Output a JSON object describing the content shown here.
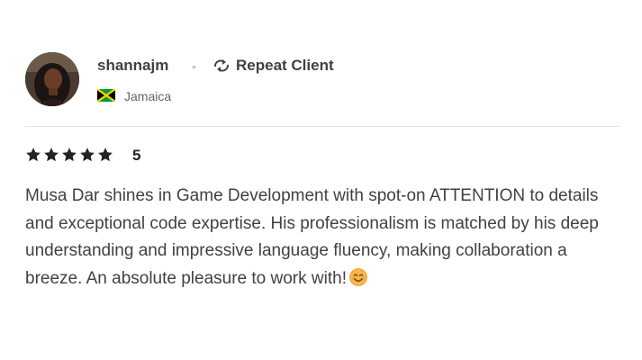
{
  "reviewer": {
    "username": "shannajm",
    "separator": "•",
    "badge_label": "Repeat Client",
    "badge_icon": "repeat-icon",
    "country": "Jamaica",
    "country_flag": "jamaica-flag-icon"
  },
  "rating": {
    "stars": 5,
    "value": "5",
    "star_color": "#222325"
  },
  "review": {
    "text": "Musa Dar shines in Game Development with spot-on ATTENTION to details and exceptional code expertise. His professionalism is matched by his deep understanding and impressive language fluency, making collaboration a breeze. An absolute pleasure to work with!",
    "emoji": "smiling-face-emoji"
  }
}
